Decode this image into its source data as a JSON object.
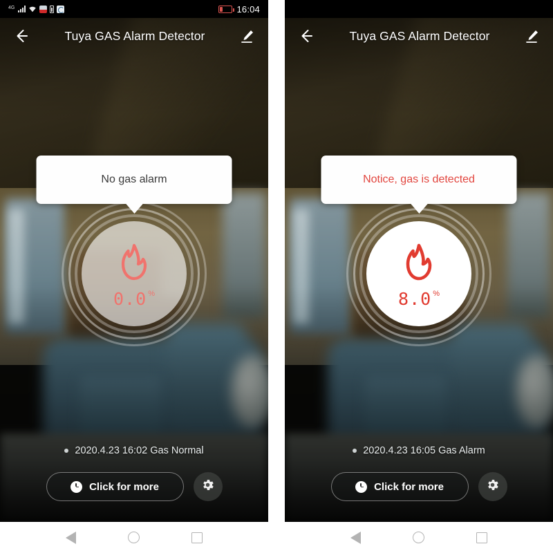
{
  "statusbar": {
    "network_label": "4G",
    "time": "16:04",
    "icons": [
      "signal-bars-icon",
      "wifi-icon",
      "alarm-clock-icon",
      "battery-small-icon",
      "app-icon",
      "battery-low-icon"
    ]
  },
  "titlebar": {
    "back_icon": "back-arrow-icon",
    "title": "Tuya GAS Alarm Detector",
    "edit_icon": "pencil-edit-icon"
  },
  "panels": [
    {
      "id": "normal",
      "bubble_text": "No gas alarm",
      "bubble_state": "normal",
      "gauge": {
        "value": "0.0",
        "unit": "%",
        "flame_color": "#f0736d",
        "disc_opacity": "0.62"
      },
      "log": {
        "dot": "status-dot",
        "text": "2020.4.23 16:02 Gas Normal"
      },
      "buttons": {
        "more_label": "Click for more",
        "more_icon": "clock-icon",
        "settings_icon": "gear-icon"
      }
    },
    {
      "id": "alarm",
      "bubble_text": "Notice, gas is detected",
      "bubble_state": "alarm",
      "gauge": {
        "value": "8.0",
        "unit": "%",
        "flame_color": "#e13b30",
        "disc_opacity": "1"
      },
      "log": {
        "dot": "status-dot",
        "text": "2020.4.23 16:05 Gas Alarm"
      },
      "buttons": {
        "more_label": "Click for more",
        "more_icon": "clock-icon",
        "settings_icon": "gear-icon"
      }
    }
  ],
  "navbar": {
    "back": "nav-back-triangle",
    "home": "nav-home-circle",
    "recents": "nav-recents-square"
  },
  "colors": {
    "alarm_red": "#e2453e",
    "normal_text": "#3a3a3a",
    "flame_normal": "#f0736d",
    "flame_alarm": "#e13b30",
    "battery_low": "#d9534f"
  }
}
